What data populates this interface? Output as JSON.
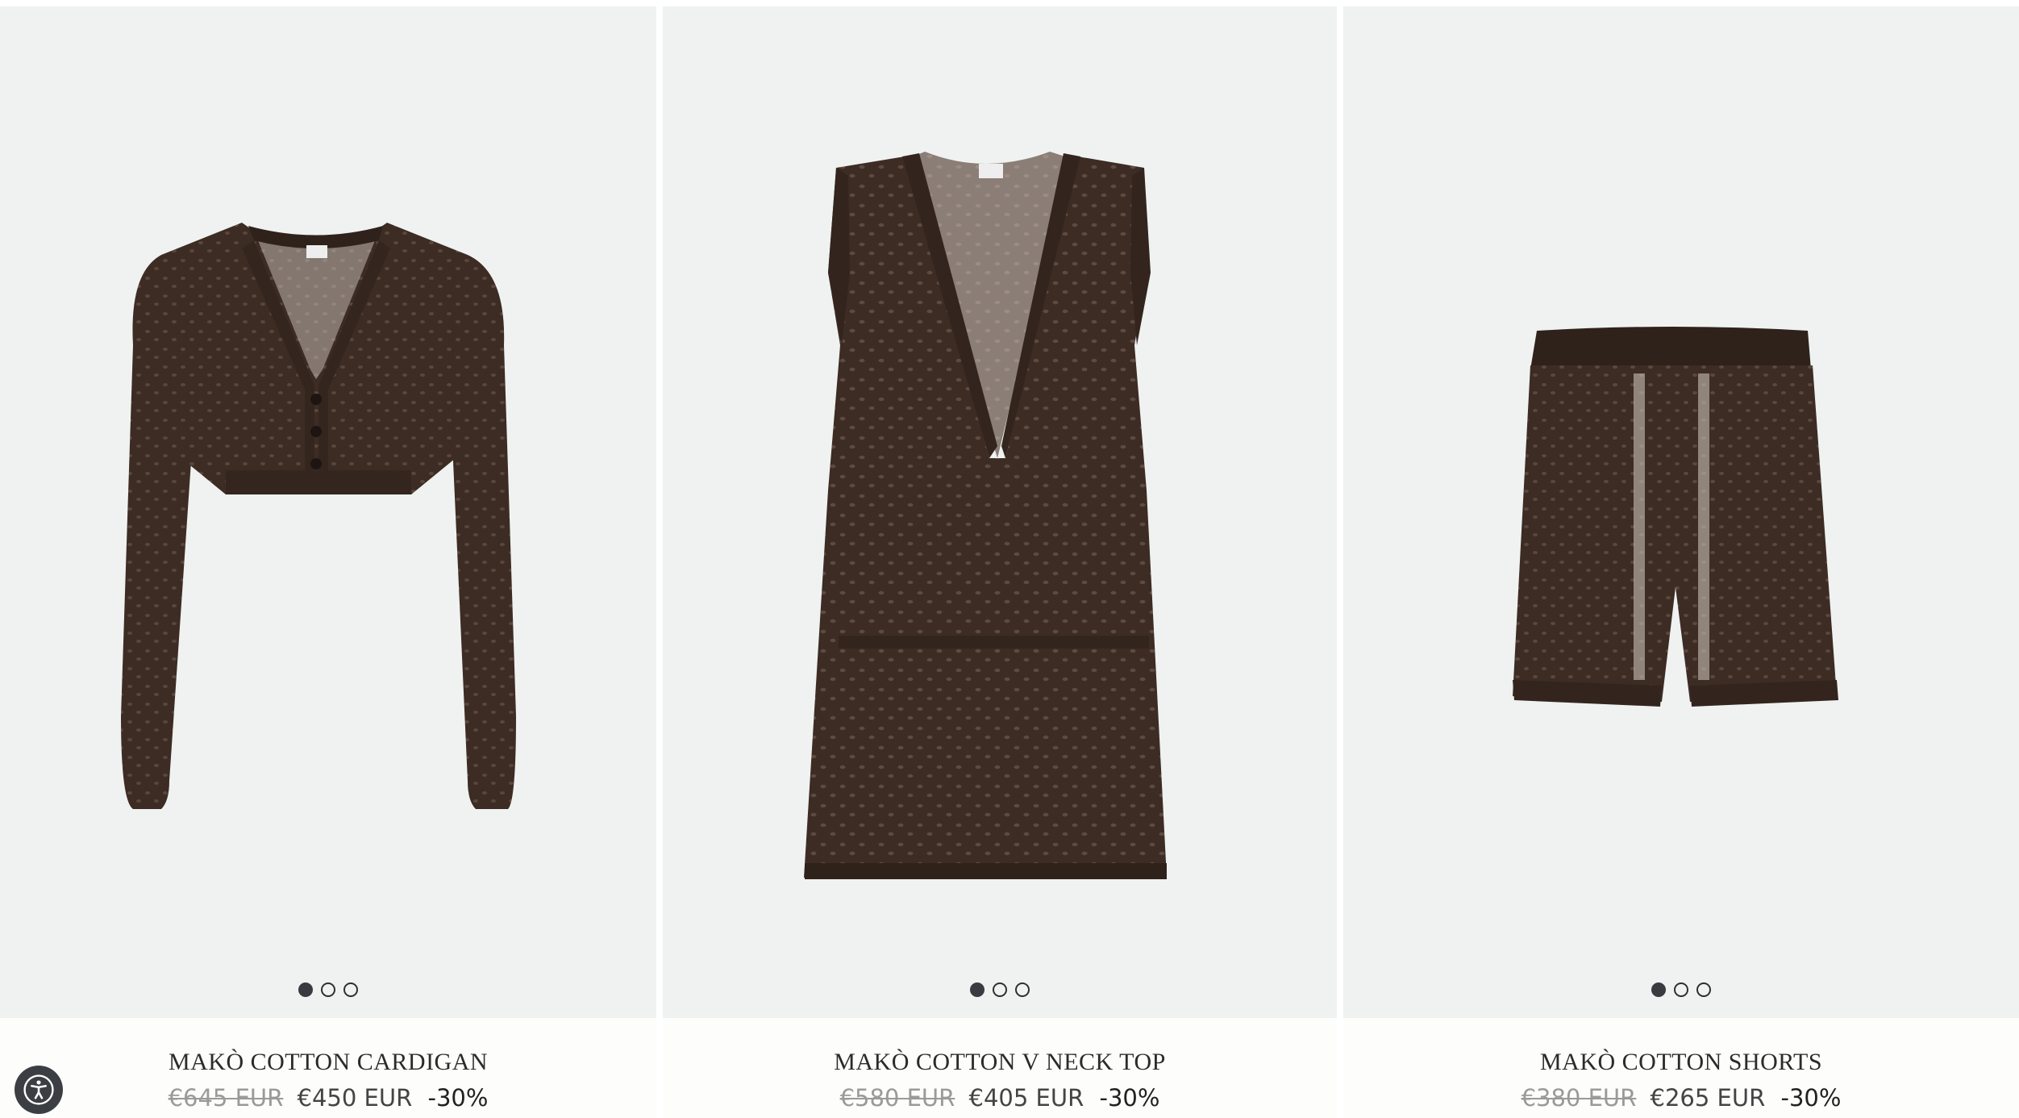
{
  "products": [
    {
      "name": "MAKÒ COTTON CARDIGAN",
      "old_price": "€645 EUR",
      "new_price": "€450 EUR",
      "discount": "-30%",
      "image_icon": "cardigan-image",
      "carousel_index": 1,
      "carousel_count": 3
    },
    {
      "name": "MAKÒ COTTON V NECK TOP",
      "old_price": "€580 EUR",
      "new_price": "€405 EUR",
      "discount": "-30%",
      "image_icon": "v-neck-top-image",
      "carousel_index": 1,
      "carousel_count": 3
    },
    {
      "name": "MAKÒ COTTON SHORTS",
      "old_price": "€380 EUR",
      "new_price": "€265 EUR",
      "discount": "-30%",
      "image_icon": "shorts-image",
      "carousel_index": 1,
      "carousel_count": 3
    }
  ],
  "accessibility_button": {
    "icon": "accessibility-icon"
  },
  "colors": {
    "product_bg": "#eff2f1",
    "garment": "#3d2c24",
    "text": "#2b2b2b",
    "old_price": "#9a9a9a"
  }
}
